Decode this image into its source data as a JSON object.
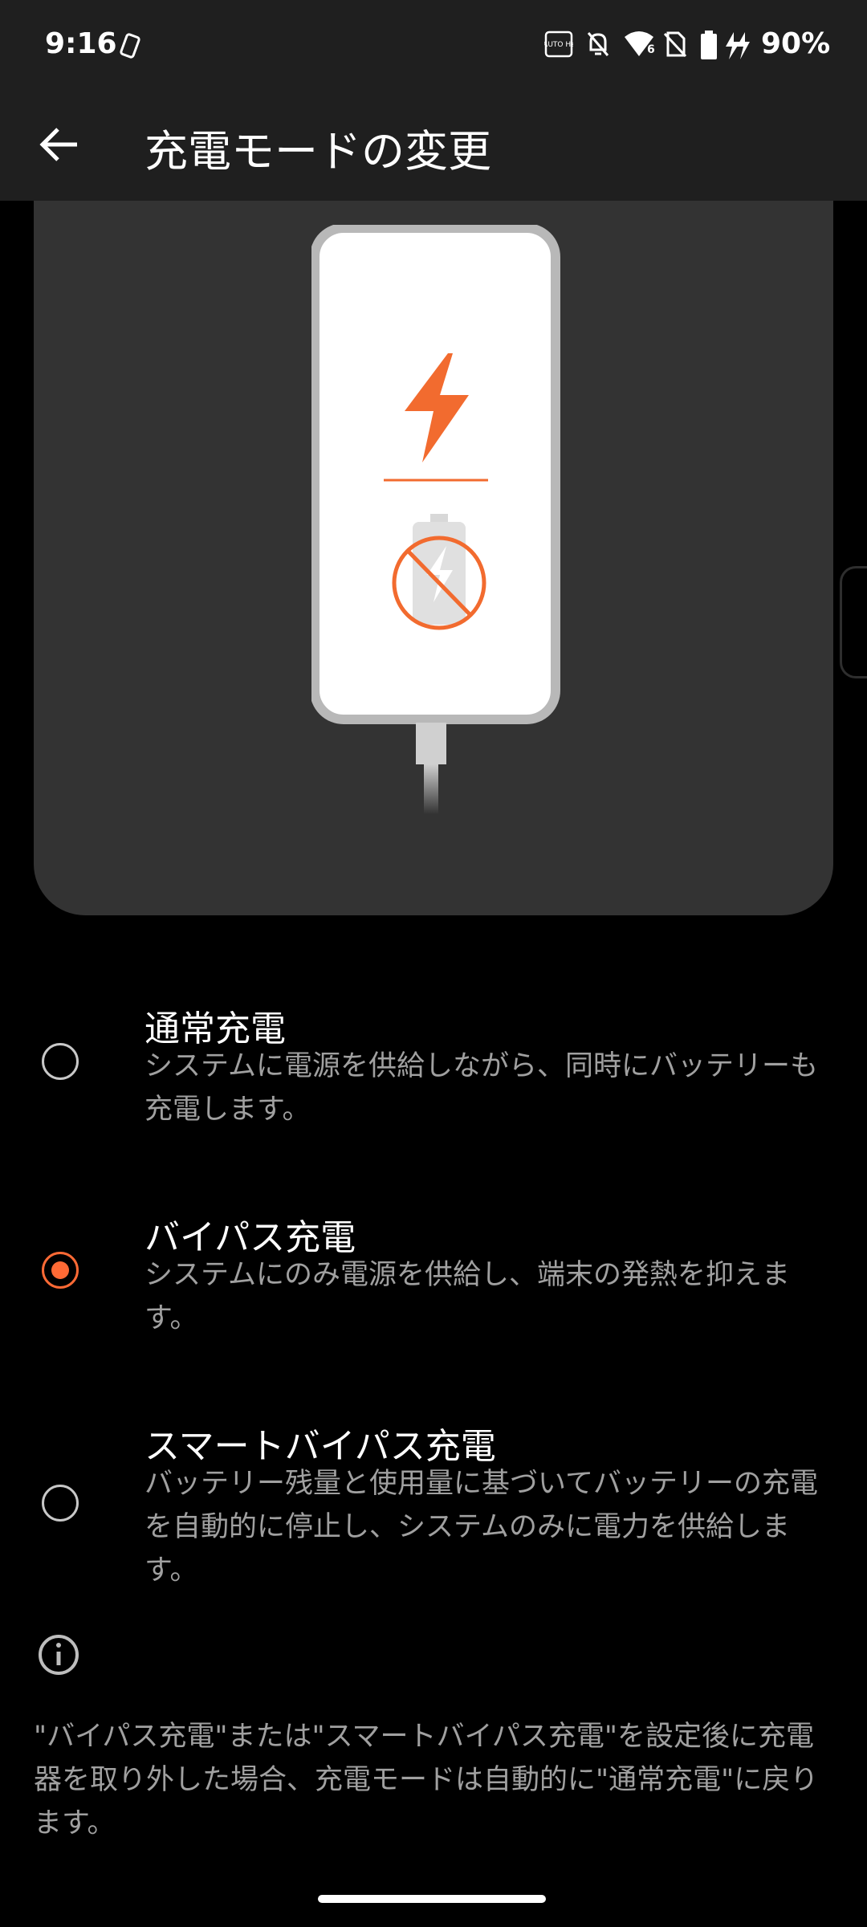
{
  "status_bar": {
    "time": "9:16",
    "battery_text": "90%",
    "icons": [
      "rotate-icon",
      "auto-hz-icon",
      "notifications-off-icon",
      "wifi-icon",
      "no-sim-icon",
      "battery-icon",
      "charging-icon"
    ],
    "auto_hz_label": "AUTO Hz",
    "wifi_badge": "6"
  },
  "app_bar": {
    "title": "充電モードの変更"
  },
  "options": [
    {
      "title": "通常充電",
      "description": "システムに電源を供給しながら、同時にバッテリーも充電します。",
      "selected": false
    },
    {
      "title": "バイパス充電",
      "description": "システムにのみ電源を供給し、端末の発熱を抑えます。",
      "selected": true
    },
    {
      "title": "スマートバイパス充電",
      "description": "バッテリー残量と使用量に基づいてバッテリーの充電を自動的に停止し、システムのみに電力を供給します。",
      "selected": false
    }
  ],
  "footer": {
    "note": "\"バイパス充電\"または\"スマートバイパス充電\"を設定後に充電器を取り外した場合、充電モードは自動的に\"通常充電\"に戻ります。"
  },
  "colors": {
    "accent": "#ff6a35",
    "bar_background": "#1f1f1f",
    "hero_background": "#333333",
    "secondary_text": "#a0a0a0"
  }
}
